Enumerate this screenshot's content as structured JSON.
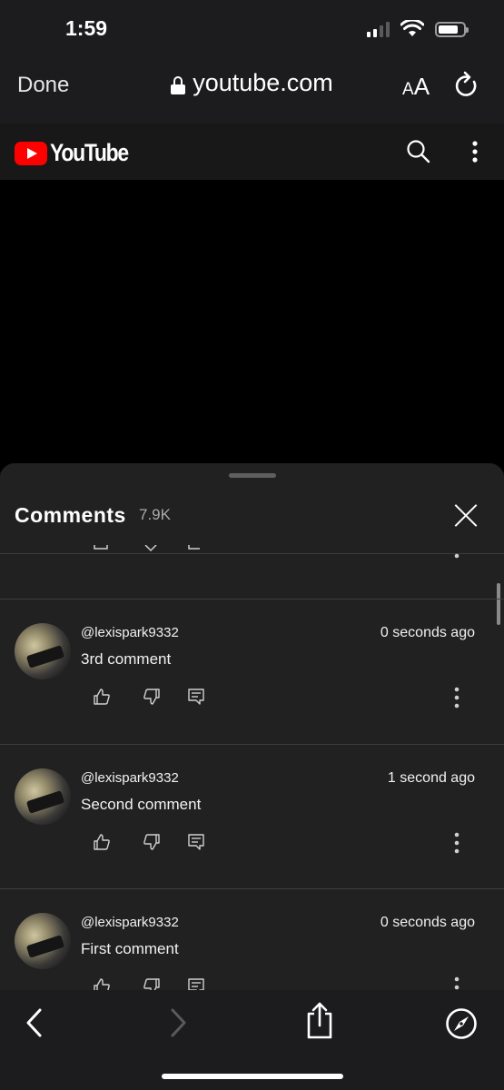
{
  "status_bar": {
    "time": "1:59",
    "icons": [
      "cellular-signal-icon",
      "wifi-icon",
      "battery-icon"
    ]
  },
  "safari": {
    "done_label": "Done",
    "url": "youtube.com",
    "text_size_label_small": "A",
    "text_size_label_large": "A",
    "icons": [
      "lock-icon",
      "reload-icon",
      "back-icon",
      "forward-icon",
      "share-icon",
      "compass-icon"
    ]
  },
  "youtube": {
    "logo_text": "YouTube",
    "icons": [
      "search-icon",
      "more-vert-icon"
    ]
  },
  "comments": {
    "title": "Comments",
    "count": "7.9K",
    "items": [
      {
        "author": "@lexispark9332",
        "time": "0 seconds ago",
        "text": "3rd comment"
      },
      {
        "author": "@lexispark9332",
        "time": "1 second ago",
        "text": "Second comment"
      },
      {
        "author": "@lexispark9332",
        "time": "0 seconds ago",
        "text": "First comment"
      }
    ]
  },
  "colors": {
    "background": "#0f0f0f",
    "sheet": "#212121",
    "youtube_red": "#ff0000",
    "chrome": "#1c1c1e"
  }
}
